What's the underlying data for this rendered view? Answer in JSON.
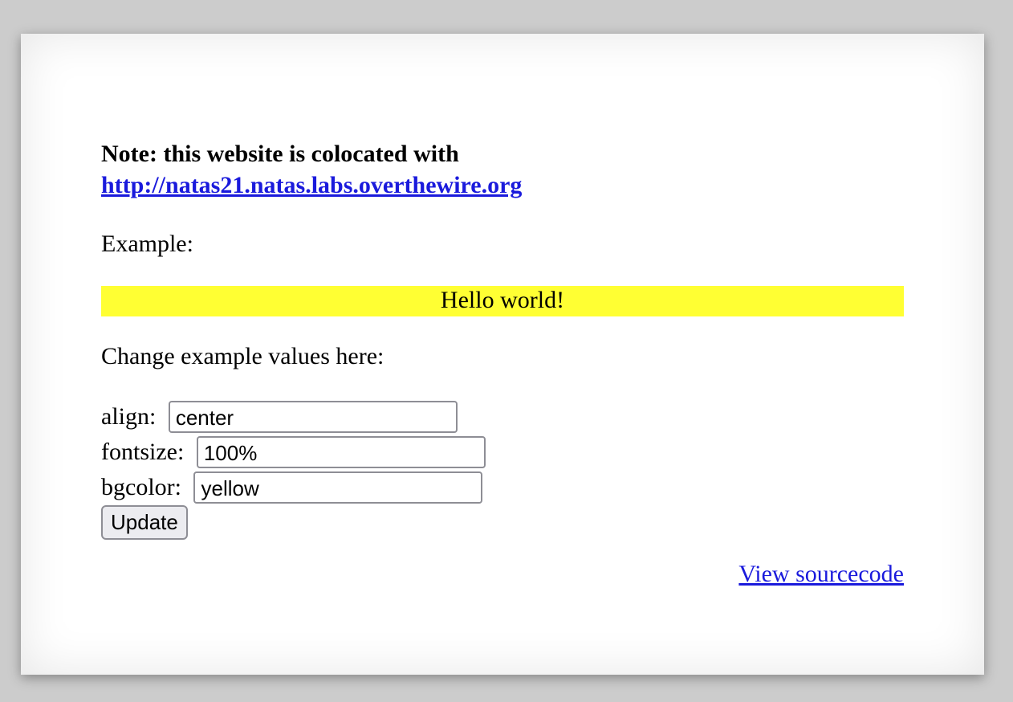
{
  "note": {
    "text": "Note: this website is colocated with",
    "link_text": "http://natas21.natas.labs.overthewire.org"
  },
  "example": {
    "label": "Example:",
    "hello_text": "Hello world!",
    "hello_bg_color": "#ffff33"
  },
  "form": {
    "title": "Change example values here:",
    "align_label": "align: ",
    "align_value": "center",
    "fontsize_label": "fontsize: ",
    "fontsize_value": "100%",
    "bgcolor_label": "bgcolor: ",
    "bgcolor_value": "yellow",
    "update_label": "Update"
  },
  "footer": {
    "view_source_label": "View sourcecode"
  },
  "colors": {
    "link": "#1a1adc",
    "page_bg": "#cccccc",
    "card_bg": "#ffffff"
  }
}
